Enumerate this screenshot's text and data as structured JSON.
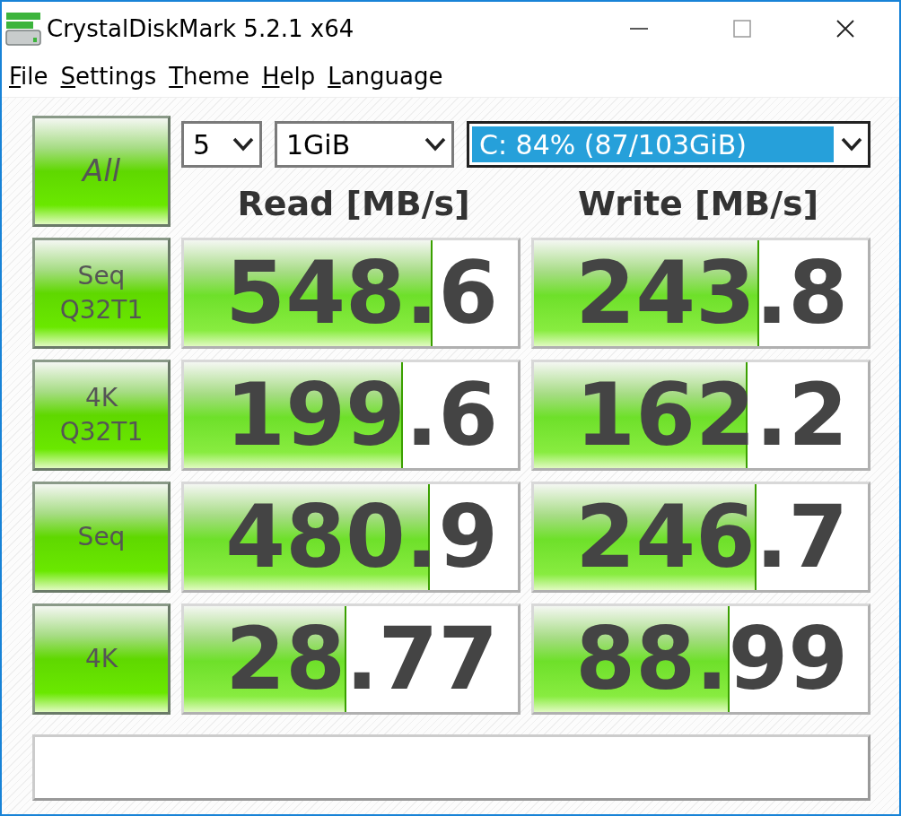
{
  "window": {
    "title": "CrystalDiskMark 5.2.1 x64"
  },
  "menu": [
    "File",
    "Settings",
    "Theme",
    "Help",
    "Language"
  ],
  "all_button": {
    "label": "All"
  },
  "selects": [
    {
      "value": "5",
      "focused": false
    },
    {
      "value": "1GiB",
      "focused": false
    },
    {
      "value": "C: 84% (87/103GiB)",
      "focused": true
    }
  ],
  "columns": [
    "Read [MB/s]",
    "Write [MB/s]"
  ],
  "rows": [
    {
      "label": "Seq\nQ32T1",
      "read": {
        "value": "548.6",
        "level": 0.74
      },
      "write": {
        "value": "243.8",
        "level": 0.67
      }
    },
    {
      "label": "4K\nQ32T1",
      "read": {
        "value": "199.6",
        "level": 0.65
      },
      "write": {
        "value": "162.2",
        "level": 0.635
      }
    },
    {
      "label": "Seq",
      "read": {
        "value": "480.9",
        "level": 0.73
      },
      "write": {
        "value": "246.7",
        "level": 0.66
      }
    },
    {
      "label": "4K",
      "read": {
        "value": "28.77",
        "level": 0.48
      },
      "write": {
        "value": "88.99",
        "level": 0.58
      }
    }
  ]
}
